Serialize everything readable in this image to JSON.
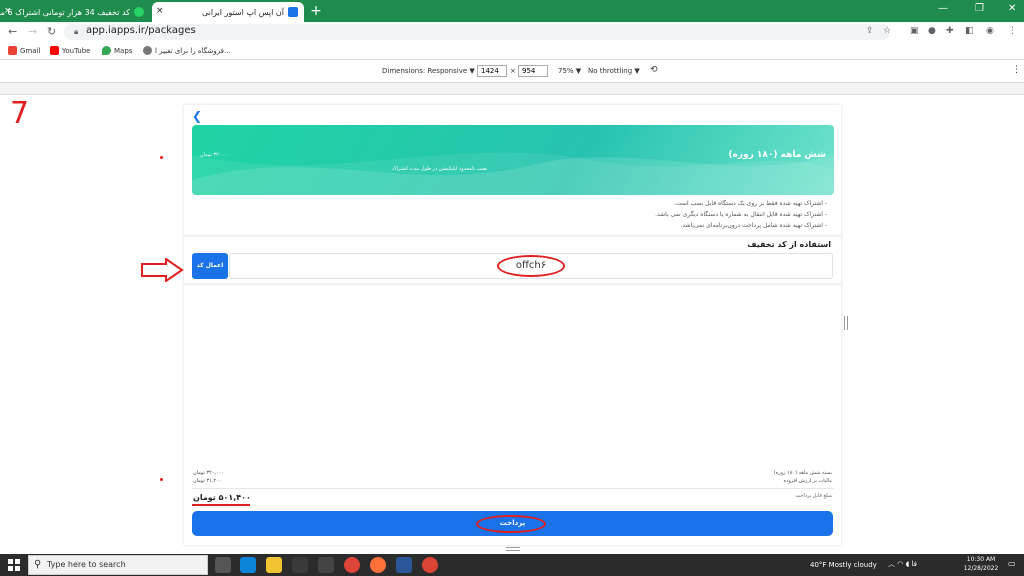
{
  "browser": {
    "tabs": [
      {
        "title": "کد تخفیف 34 هزار تومانی اشتراک 6 ما...",
        "close": "×"
      },
      {
        "title": "آن اپس اپ استور ایرانی",
        "close": "×"
      }
    ],
    "new_tab": "+",
    "url": "app.iapps.ir/packages",
    "bookmarks": [
      "Gmail",
      "YouTube",
      "Maps",
      "فروشگاه را برای تغییر ا..."
    ]
  },
  "devtools": {
    "dimensions_label": "Dimensions: Responsive ▼",
    "width": "1424",
    "times": "×",
    "height": "954",
    "zoom": "75% ▼",
    "throttling": "No throttling ▼"
  },
  "annotation": {
    "step_number": "7"
  },
  "package": {
    "title": "شش ماهه (۱۸۰ روزه)",
    "price": "۳۲۰۰۰۰ تومان",
    "note": "نصب نامحدود اپلیکیشن در طول مدت اشتراک",
    "features": [
      "- اشتراک تهیه شده فقط بر روی یک دستگاه قابل نصب است.",
      "- اشتراک تهیه شده قابل انتقال به شماره یا دستگاه دیگری نمی باشد.",
      "- اشتراک تهیه شده شامل پرداخت درون‌برنامه‌ای نمی‌باشد."
    ]
  },
  "discount": {
    "label": "استفاده از کد تخفیف",
    "code_value": "offch۶",
    "apply_label": "اعمال کد"
  },
  "summary": {
    "package_line": "بسته شش ماهه (۱۸۰ روزه)",
    "package_amount": "۳۲۰,۰۰۰ تومان",
    "vat_line": "مالیات بر ارزش افزوده",
    "vat_amount": "۳۱,۲۰۰ تومان",
    "payable_label": "مبلغ قابل پرداخت",
    "payable_amount": "۵۰۱,۴۰۰ تومان"
  },
  "pay_button": "پرداخت",
  "taskbar": {
    "search_placeholder": "Type here to search",
    "weather": "40°F  Mostly cloudy",
    "lang": "فا",
    "time": "10:30 AM",
    "date": "12/28/2022"
  },
  "colors": {
    "accent": "#1a73e8",
    "annotation_red": "#e02020",
    "banner_green": "#1fd4a4",
    "tabstrip_green": "#1f8b4c"
  }
}
